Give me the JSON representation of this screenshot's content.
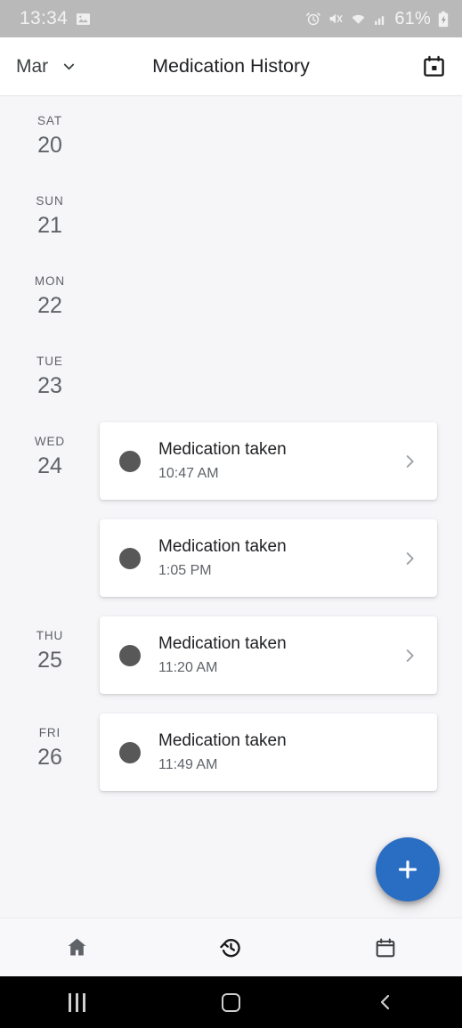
{
  "status_bar": {
    "time": "13:34",
    "battery_percent": "61%",
    "icons": [
      "photo-icon",
      "alarm-icon",
      "mute-icon",
      "wifi-icon",
      "signal-icon",
      "battery-charging-icon"
    ]
  },
  "app_bar": {
    "month_label": "Mar",
    "month_dropdown_icon": "chevron-down-icon",
    "title": "Medication History",
    "calendar_icon": "calendar-icon"
  },
  "days": [
    {
      "dow": "SAT",
      "num": "20",
      "entries": []
    },
    {
      "dow": "SUN",
      "num": "21",
      "entries": []
    },
    {
      "dow": "MON",
      "num": "22",
      "entries": []
    },
    {
      "dow": "TUE",
      "num": "23",
      "entries": []
    },
    {
      "dow": "WED",
      "num": "24",
      "entries": [
        {
          "title": "Medication taken",
          "time": "10:47 AM",
          "chevron": true
        },
        {
          "title": "Medication taken",
          "time": "1:05 PM",
          "chevron": true
        }
      ]
    },
    {
      "dow": "THU",
      "num": "25",
      "entries": [
        {
          "title": "Medication taken",
          "time": "11:20 AM",
          "chevron": true
        }
      ]
    },
    {
      "dow": "FRI",
      "num": "26",
      "entries": [
        {
          "title": "Medication taken",
          "time": "11:49 AM",
          "chevron": false
        }
      ]
    }
  ],
  "fab": {
    "icon": "plus-icon",
    "color": "#2a6ec4"
  },
  "bottom_nav": {
    "items": [
      {
        "name": "home",
        "icon": "home-icon",
        "selected": false
      },
      {
        "name": "history",
        "icon": "history-icon",
        "selected": true
      },
      {
        "name": "calendar",
        "icon": "calendar-outline-icon",
        "selected": false
      }
    ]
  },
  "system_nav": {
    "recents_icon": "recents-icon",
    "home_icon": "home-square-icon",
    "back_icon": "back-chevron-icon"
  },
  "colors": {
    "background": "#f6f5f8",
    "card": "#ffffff",
    "accent": "#2a6ec4",
    "dot": "#585858",
    "text_primary": "#202124",
    "text_secondary": "#5f6368"
  }
}
